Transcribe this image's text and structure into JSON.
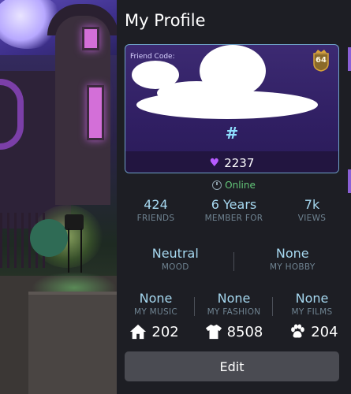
{
  "profile": {
    "title": "My Profile",
    "friend_code_label": "Friend Code:",
    "level": "64",
    "hash_symbol": "#",
    "likes": "2237",
    "status": "Online"
  },
  "stats_row1": [
    {
      "value": "424",
      "label": "FRIENDS"
    },
    {
      "value": "6 Years",
      "label": "MEMBER FOR"
    },
    {
      "value": "7k",
      "label": "VIEWS"
    }
  ],
  "stats_row2": [
    {
      "value": "Neutral",
      "label": "MOOD"
    },
    {
      "value": "None",
      "label": "MY HOBBY"
    }
  ],
  "stats_row3": [
    {
      "value": "None",
      "label": "MY MUSIC"
    },
    {
      "value": "None",
      "label": "MY FASHION"
    },
    {
      "value": "None",
      "label": "MY FILMS"
    }
  ],
  "resources": {
    "rooms": "202",
    "clothes": "8508",
    "pets": "204"
  },
  "actions": {
    "edit_label": "Edit"
  },
  "colors": {
    "panel_bg": "#1d1e24",
    "card_purple": "#3c2a72",
    "stat_value": "#a6d8f0",
    "online_green": "#63c87a",
    "heart_purple": "#b65bff"
  }
}
